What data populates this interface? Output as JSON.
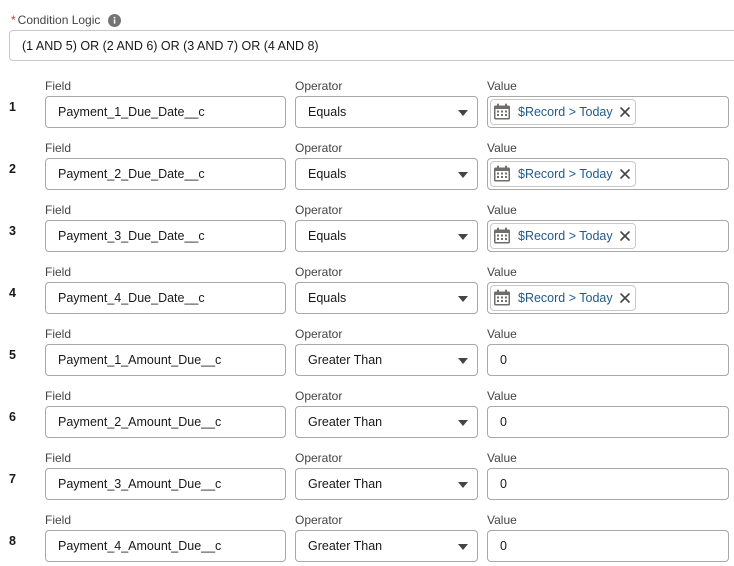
{
  "condition_logic": {
    "required_marker": "*",
    "label": "Condition Logic",
    "value": "(1 AND 5) OR (2 AND 6) OR (3 AND 7) OR (4 AND 8)"
  },
  "column_labels": {
    "field": "Field",
    "operator": "Operator",
    "value": "Value"
  },
  "conditions": [
    {
      "num": "1",
      "field": "Payment_1_Due_Date__c",
      "operator": "Equals",
      "value": "$Record > Today",
      "value_type": "resource"
    },
    {
      "num": "2",
      "field": "Payment_2_Due_Date__c",
      "operator": "Equals",
      "value": "$Record > Today",
      "value_type": "resource"
    },
    {
      "num": "3",
      "field": "Payment_3_Due_Date__c",
      "operator": "Equals",
      "value": "$Record > Today",
      "value_type": "resource"
    },
    {
      "num": "4",
      "field": "Payment_4_Due_Date__c",
      "operator": "Equals",
      "value": "$Record > Today",
      "value_type": "resource"
    },
    {
      "num": "5",
      "field": "Payment_1_Amount_Due__c",
      "operator": "Greater Than",
      "value": "0",
      "value_type": "text"
    },
    {
      "num": "6",
      "field": "Payment_2_Amount_Due__c",
      "operator": "Greater Than",
      "value": "0",
      "value_type": "text"
    },
    {
      "num": "7",
      "field": "Payment_3_Amount_Due__c",
      "operator": "Greater Than",
      "value": "0",
      "value_type": "text"
    },
    {
      "num": "8",
      "field": "Payment_4_Amount_Due__c",
      "operator": "Greater Than",
      "value": "0",
      "value_type": "text"
    }
  ],
  "icons": {
    "info": "info-icon",
    "calendar": "calendar-icon",
    "remove": "close-icon",
    "dropdown": "chevron-down-icon"
  },
  "colors": {
    "pill_text": "#235a8a",
    "required": "#c23934",
    "calendar_icon": "#706e6b"
  }
}
